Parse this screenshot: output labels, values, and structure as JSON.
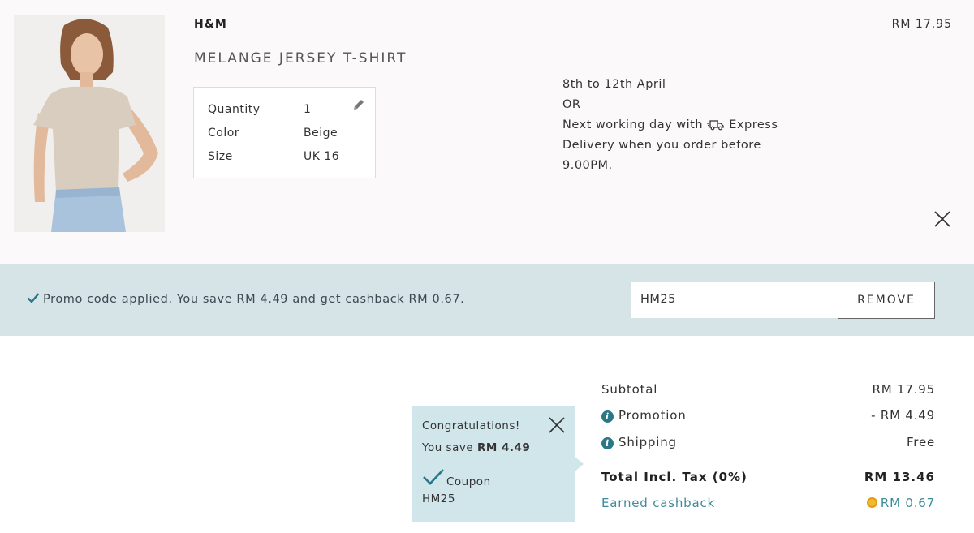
{
  "product": {
    "brand": "H&M",
    "name": "MELANGE JERSEY T-SHIRT",
    "price": "RM 17.95",
    "quantity_label": "Quantity",
    "quantity_value": "1",
    "color_label": "Color",
    "color_value": "Beige",
    "size_label": "Size",
    "size_value": "UK 16"
  },
  "delivery": {
    "line1": "8th to 12th April",
    "line2": "OR",
    "line3_prefix": "Next working day with",
    "line3_suffix": "Express",
    "line4": "Delivery when you order before",
    "line5": "9.00PM."
  },
  "promo": {
    "message": "Promo code applied. You save RM 4.49 and get cashback RM 0.67.",
    "code_value": "HM25",
    "remove_label": "REMOVE"
  },
  "tooltip": {
    "line1": "Congratulations!",
    "save_prefix": "You save",
    "save_amount": "RM 4.49",
    "coupon_label": "Coupon",
    "coupon_code": "HM25"
  },
  "summary": {
    "subtotal_label": "Subtotal",
    "subtotal_value": "RM 17.95",
    "promotion_label": "Promotion",
    "promotion_value": "- RM 4.49",
    "shipping_label": "Shipping",
    "shipping_value": "Free",
    "total_label": "Total Incl. Tax (0%)",
    "total_value": "RM 13.46",
    "cashback_label": "Earned cashback",
    "cashback_value": "RM 0.67"
  },
  "colors": {
    "promo_bar": "#d6e4e8",
    "tooltip_bg": "#d0e6ea",
    "accent_teal": "#2a7787",
    "cashback_text": "#3f8a9b",
    "coin": "#f1b92c"
  },
  "icons": [
    "pencil-icon",
    "truck-icon",
    "close-icon",
    "check-icon",
    "info-icon",
    "coin-icon"
  ]
}
